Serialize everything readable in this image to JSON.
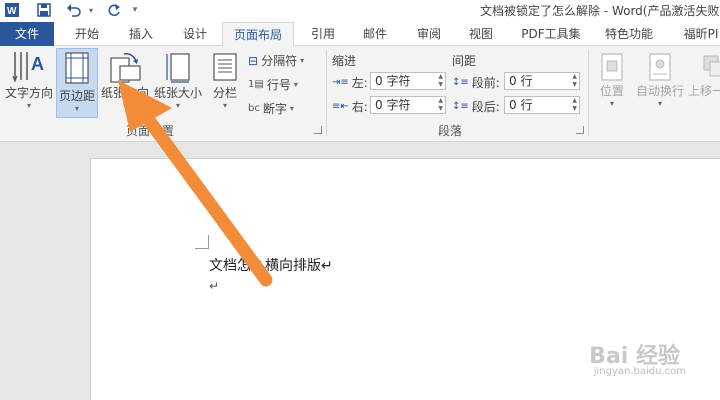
{
  "window": {
    "title": "文档被锁定了怎么解除 - Word(产品激活失败"
  },
  "quick_access": {
    "icons": [
      "word-icon",
      "save-icon",
      "undo-icon",
      "redo-icon",
      "customize-icon"
    ]
  },
  "tabs": [
    {
      "label": "文件"
    },
    {
      "label": "开始"
    },
    {
      "label": "插入"
    },
    {
      "label": "设计"
    },
    {
      "label": "页面布局"
    },
    {
      "label": "引用"
    },
    {
      "label": "邮件"
    },
    {
      "label": "审阅"
    },
    {
      "label": "视图"
    },
    {
      "label": "PDF工具集"
    },
    {
      "label": "特色功能"
    },
    {
      "label": "福昕PI"
    }
  ],
  "ribbon": {
    "page_setup": {
      "text_direction": "文字方向",
      "margins": "页边距",
      "orientation": "纸张方向",
      "size": "纸张大小",
      "columns": "分栏",
      "breaks": "分隔符",
      "line_numbers": "行号",
      "hyphenation": "断字",
      "group_label": "页面设置"
    },
    "paragraph": {
      "indent_title": "缩进",
      "spacing_title": "间距",
      "left_label": "左:",
      "right_label": "右:",
      "before_label": "段前:",
      "after_label": "段后:",
      "left_value": "0 字符",
      "right_value": "0 字符",
      "before_value": "0 行",
      "after_value": "0 行",
      "group_label": "段落"
    },
    "arrange": {
      "position": "位置",
      "wrap_text": "自动换行",
      "bring_forward": "上移一"
    }
  },
  "document": {
    "line1": "文档怎么横向排版↵",
    "line2": "↵"
  },
  "watermark": {
    "brand": "Bai 经验",
    "url": "jingyan.baidu.com"
  },
  "colors": {
    "file_tab": "#2b579a",
    "accent": "#2b579a",
    "annotation_arrow": "#f28c38",
    "selected_button": "#c5d9f0"
  }
}
